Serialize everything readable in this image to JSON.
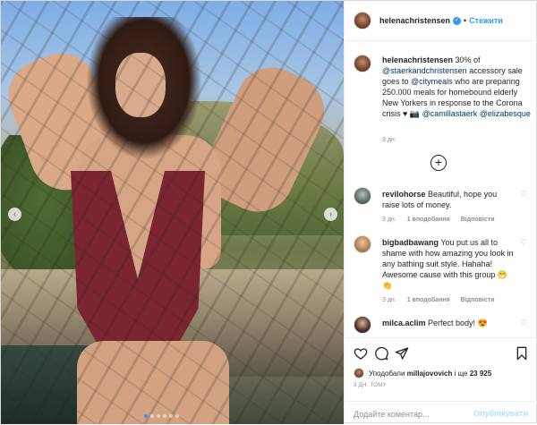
{
  "post": {
    "author": {
      "username": "helenachristensen",
      "verified_glyph": "✓",
      "separator": "•",
      "follow_label": "Стежити"
    },
    "photo": {
      "nav_prev": "‹",
      "nav_next": "›",
      "slides_total": 6,
      "active_slide": 1
    },
    "caption": {
      "username": "helenachristensen",
      "parts": [
        {
          "type": "text",
          "value": " 30% of "
        },
        {
          "type": "mention",
          "value": "@staerkandchristensen"
        },
        {
          "type": "text",
          "value": " accessory sale goes to "
        },
        {
          "type": "mention",
          "value": "@citymeals"
        },
        {
          "type": "text",
          "value": " who are preparing 250.000 meals for homebound elderly New Yorkers in response to the Corona crisis ♥ 📷 "
        },
        {
          "type": "mention",
          "value": "@camillastaerk"
        },
        {
          "type": "text",
          "value": " "
        },
        {
          "type": "mention",
          "value": "@elizabesque"
        }
      ],
      "time": "3 дн."
    },
    "load_more_icon": "+",
    "comments": [
      {
        "username": "revilohorse",
        "text": " Beautiful, hope you raise lots of money.",
        "time": "3 дн.",
        "likes": "1 вподобання",
        "reply": "Відповісти"
      },
      {
        "username": "bigbadbawang",
        "text": " You put us all to shame with how amazing you look in any bathing suit style. Hahaha! Awesome cause with this group 😁👏",
        "time": "3 дн.",
        "likes": "1 вподобання",
        "reply": "Відповісти"
      },
      {
        "username": "milca.aclim",
        "text": " Perfect body! 😍",
        "time": "",
        "likes": "",
        "reply": ""
      }
    ],
    "actions": {
      "like_icon": "heart-icon",
      "comment_icon": "comment-icon",
      "share_icon": "share-icon",
      "save_icon": "bookmark-icon"
    },
    "liked_by": {
      "prefix": "Уподобали ",
      "user": "millajovovich",
      "middle": " і ще ",
      "count": "23 925"
    },
    "date": "3 ДН. ТОМУ",
    "add_comment": {
      "placeholder": "Додайте коментар...",
      "publish_label": "Опублікувати"
    }
  },
  "colors": {
    "accent": "#3897f0",
    "mention": "#00376b",
    "muted": "#8e8e8e",
    "publish_disabled": "#b2dffc"
  }
}
